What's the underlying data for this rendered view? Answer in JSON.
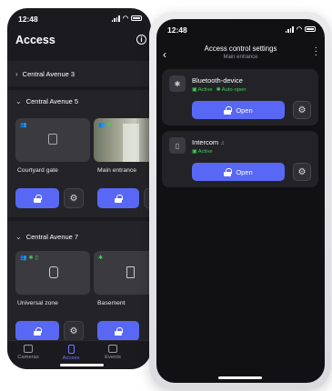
{
  "left_phone": {
    "status": {
      "time": "12:48"
    },
    "title": "Access",
    "sections": [
      {
        "name": "Central Avenue 3",
        "expanded": false
      },
      {
        "name": "Central Avenue 5",
        "expanded": true,
        "tiles": [
          {
            "label": "Courtyard gate",
            "icon": "door-handle-icon"
          },
          {
            "label": "Main entrance",
            "icon": "camera-feed-image"
          }
        ]
      },
      {
        "name": "Central Avenue 7",
        "expanded": true,
        "tiles": [
          {
            "label": "Universal zone",
            "icon": "shield-icon"
          },
          {
            "label": "Basement",
            "icon": "door-exit-icon"
          }
        ]
      }
    ],
    "tabs": [
      {
        "label": "Cameras",
        "active": false
      },
      {
        "label": "Access",
        "active": true
      },
      {
        "label": "Events",
        "active": false
      }
    ]
  },
  "right_phone": {
    "status": {
      "time": "12:48"
    },
    "title": "Access control settings",
    "subtitle": "Main entrance",
    "devices": [
      {
        "name": "Bluetooth-device",
        "icon": "bluetooth-icon",
        "status": [
          "Active",
          "Auto-open"
        ],
        "button": "Open"
      },
      {
        "name": "Intercom",
        "icon": "intercom-icon",
        "status": [
          "Active"
        ],
        "button": "Open"
      }
    ]
  },
  "colors": {
    "accent": "#5868f5",
    "active_green": "#3fcf5c",
    "background": "#1b1b1f"
  }
}
